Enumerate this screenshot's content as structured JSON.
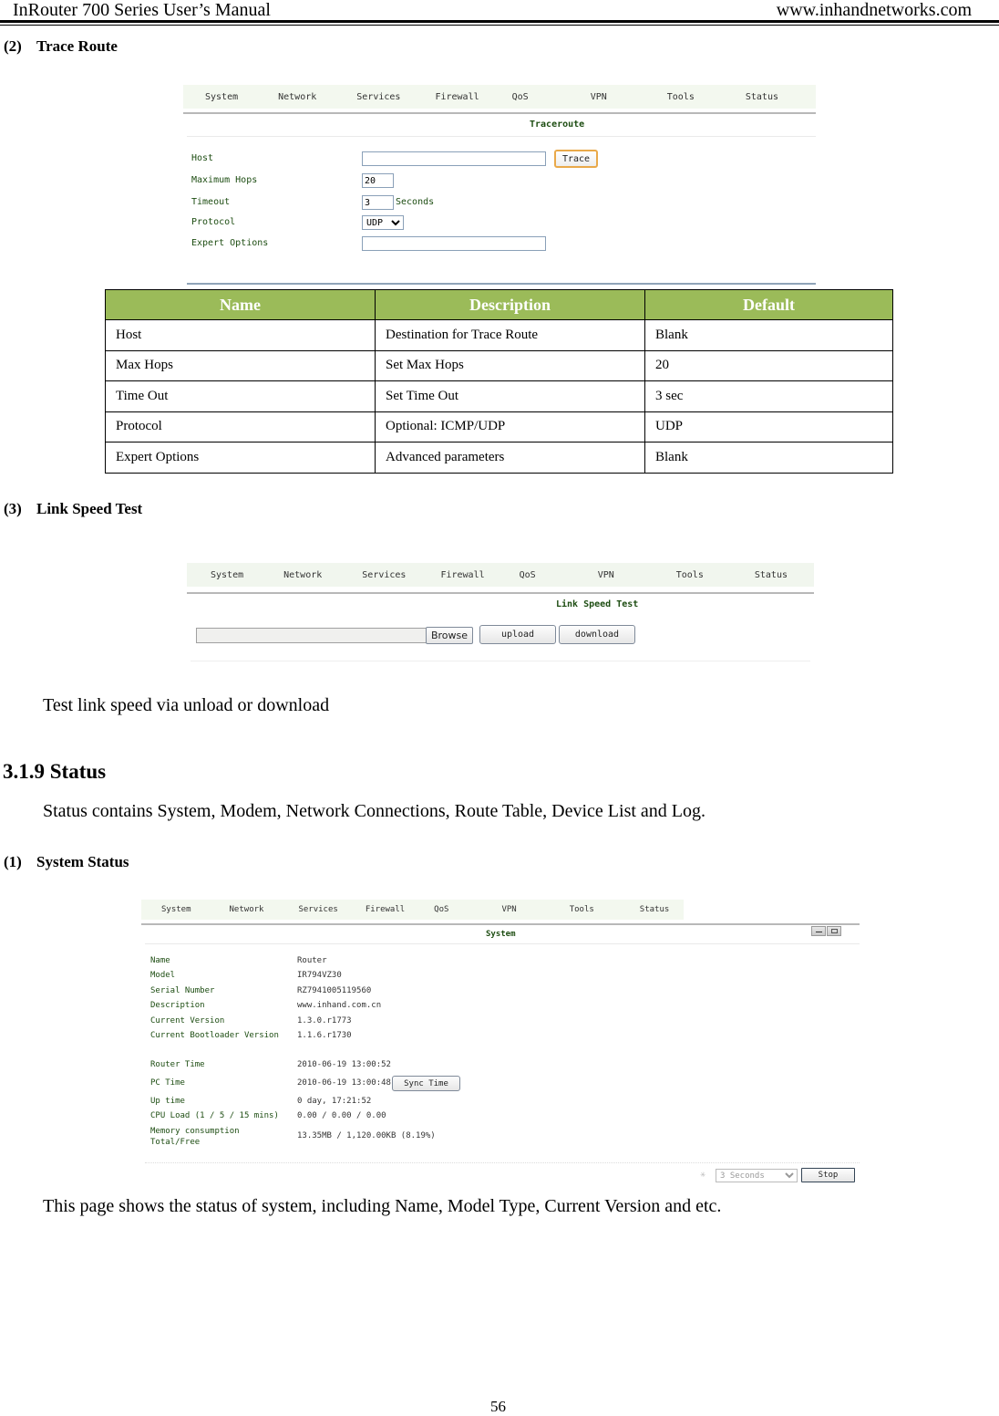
{
  "page_header": {
    "title": "InRouter 700 Series User’s Manual",
    "website": "www.inhandnetworks.com"
  },
  "nav_items": [
    "System",
    "Network",
    "Services",
    "Firewall",
    "QoS",
    "VPN",
    "Tools",
    "Status"
  ],
  "trace_route": {
    "section_number": "(2)",
    "section_title": "Trace Route",
    "ui": {
      "panel_title": "Traceroute",
      "fields": {
        "host": {
          "label": "Host",
          "value": ""
        },
        "max_hops": {
          "label": "Maximum Hops",
          "value": "20"
        },
        "timeout": {
          "label": "Timeout",
          "value": "3",
          "unit": "Seconds"
        },
        "protocol": {
          "label": "Protocol",
          "selected": "UDP"
        },
        "expert_options": {
          "label": "Expert Options",
          "value": ""
        }
      },
      "trace_button": "Trace"
    },
    "table": {
      "headers": [
        "Name",
        "Description",
        "Default"
      ],
      "rows": [
        [
          "Host",
          "Destination for Trace Route",
          "Blank"
        ],
        [
          "Max Hops",
          "Set Max Hops",
          "20"
        ],
        [
          "Time Out",
          "Set Time Out",
          "3 sec"
        ],
        [
          "Protocol",
          "Optional: ICMP/UDP",
          "UDP"
        ],
        [
          "Expert Options",
          "Advanced parameters",
          "Blank"
        ]
      ],
      "header_color": "#9bbb59"
    }
  },
  "link_speed_test": {
    "section_number": "(3)",
    "section_title": "Link Speed Test",
    "ui": {
      "panel_title": "Link Speed Test",
      "file_value": "",
      "browse_button": "Browse",
      "upload_button": "upload",
      "download_button": "download"
    },
    "description": "Test link speed via unload or download"
  },
  "status_section": {
    "heading": "3.1.9 Status",
    "intro": "Status contains System, Modem, Network Connections, Route Table, Device List and Log."
  },
  "system_status": {
    "section_number": "(1)",
    "section_title": "System Status",
    "ui": {
      "panel_title": "System",
      "rows": [
        {
          "label": "Name",
          "value": "Router"
        },
        {
          "label": "Model",
          "value": "IR794VZ30"
        },
        {
          "label": "Serial Number",
          "value": "RZ7941005119560"
        },
        {
          "label": "Description",
          "value": "www.inhand.com.cn"
        },
        {
          "label": "Current Version",
          "value": "1.3.0.r1773"
        },
        {
          "label": "Current Bootloader Version",
          "value": "1.1.6.r1730"
        }
      ],
      "rows2": [
        {
          "label": "Router Time",
          "value": "2010-06-19 13:00:52"
        },
        {
          "label": "PC Time",
          "value": "2010-06-19 13:00:48"
        },
        {
          "label": "Up time",
          "value": "0 day, 17:21:52"
        },
        {
          "label": "CPU Load (1 / 5 / 15 mins)",
          "value": "0.00 / 0.00 / 0.00"
        },
        {
          "label": "Memory consumption Total/Free",
          "value": "13.35MB / 1,120.00KB (8.19%)"
        }
      ],
      "sync_time_button": "Sync Time",
      "refresh_interval": "3 Seconds",
      "stop_button": "Stop"
    },
    "description": "This page shows the status of system, including Name, Model Type, Current Version and etc."
  },
  "page_number": "56"
}
